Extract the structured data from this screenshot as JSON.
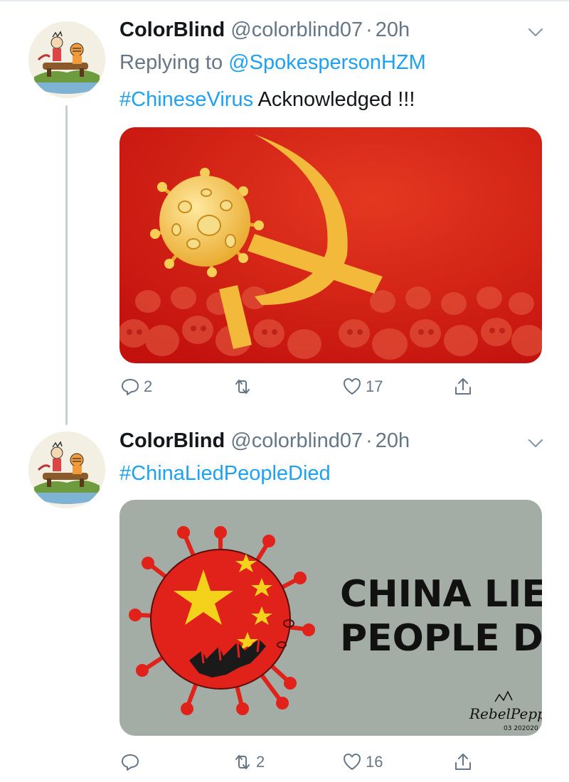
{
  "tweets": [
    {
      "display_name": "ColorBlind",
      "handle": "@colorblind07",
      "separator": "·",
      "time": "20h",
      "replying_prefix": "Replying to",
      "replying_to": "@SpokespersonHZM",
      "hashtag": "#ChineseVirus",
      "text": " Acknowledged !!!",
      "actions": {
        "reply_count": "2",
        "retweet_count": "",
        "like_count": "17"
      }
    },
    {
      "display_name": "ColorBlind",
      "handle": "@colorblind07",
      "separator": "·",
      "time": "20h",
      "hashtag": "#ChinaLiedPeopleDied",
      "image": {
        "line1": "CHINA LIED",
        "line2": "PEOPLE DIED",
        "signature": "RebelPepper",
        "signature_date": "03 202020"
      },
      "actions": {
        "reply_count": "",
        "retweet_count": "2",
        "like_count": "16"
      }
    }
  ],
  "icons": [
    "avatar",
    "chevron-down-icon",
    "reply-icon",
    "retweet-icon",
    "like-icon",
    "share-icon",
    "virus-icon",
    "hammer-sickle-icon"
  ],
  "colors": {
    "link": "#1da1f2",
    "muted": "#657786",
    "flag_red": "#e0221a",
    "gold": "#f4c23a",
    "gray_panel": "#a3ada6"
  }
}
